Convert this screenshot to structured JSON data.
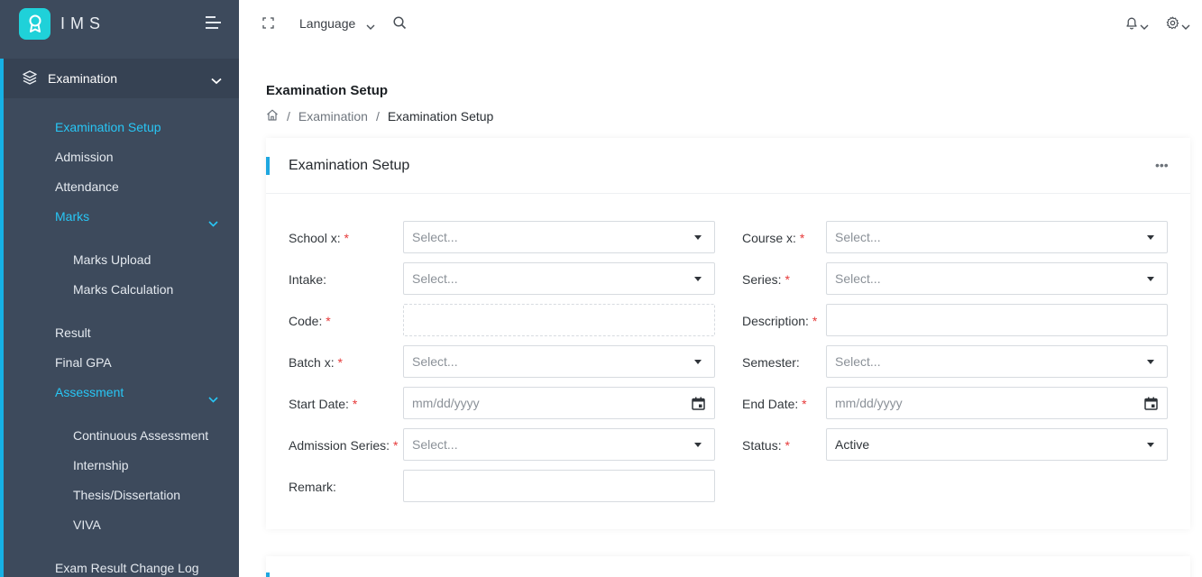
{
  "app": {
    "name": "IMS"
  },
  "sidebar": {
    "section": "Examination",
    "items": [
      {
        "label": "Examination Setup"
      },
      {
        "label": "Admission"
      },
      {
        "label": "Attendance"
      },
      {
        "label": "Marks"
      },
      {
        "label": "Marks Upload"
      },
      {
        "label": "Marks Calculation"
      },
      {
        "label": "Result"
      },
      {
        "label": "Final GPA"
      },
      {
        "label": "Assessment"
      },
      {
        "label": "Continuous Assessment"
      },
      {
        "label": "Internship"
      },
      {
        "label": "Thesis/Dissertation"
      },
      {
        "label": "VIVA"
      },
      {
        "label": "Exam Result Change Log"
      }
    ]
  },
  "topbar": {
    "language_label": "Language"
  },
  "page": {
    "title": "Examination Setup",
    "breadcrumb": [
      "Examination",
      "Examination Setup"
    ]
  },
  "card": {
    "title": "Examination Setup",
    "more": "•••"
  },
  "form": {
    "required_mark": "*",
    "school": {
      "label": "School x:",
      "placeholder": "Select..."
    },
    "course": {
      "label": "Course x:",
      "placeholder": "Select..."
    },
    "intake": {
      "label": "Intake:",
      "placeholder": "Select..."
    },
    "series": {
      "label": "Series:",
      "placeholder": "Select..."
    },
    "code": {
      "label": "Code:",
      "value": ""
    },
    "description": {
      "label": "Description:",
      "value": ""
    },
    "batch": {
      "label": "Batch x:",
      "placeholder": "Select..."
    },
    "semester": {
      "label": "Semester:",
      "placeholder": "Select..."
    },
    "start_date": {
      "label": "Start Date:",
      "placeholder": "mm/dd/yyyy"
    },
    "end_date": {
      "label": "End Date:",
      "placeholder": "mm/dd/yyyy"
    },
    "admission_series": {
      "label": "Admission Series:",
      "placeholder": "Select..."
    },
    "status": {
      "label": "Status:",
      "value": "Active"
    },
    "remark": {
      "label": "Remark:",
      "value": ""
    }
  },
  "colors": {
    "accent": "#16b1e5",
    "sidebar": "#3d4a5c",
    "logo": "#1fd1d9",
    "required": "#e63939"
  }
}
